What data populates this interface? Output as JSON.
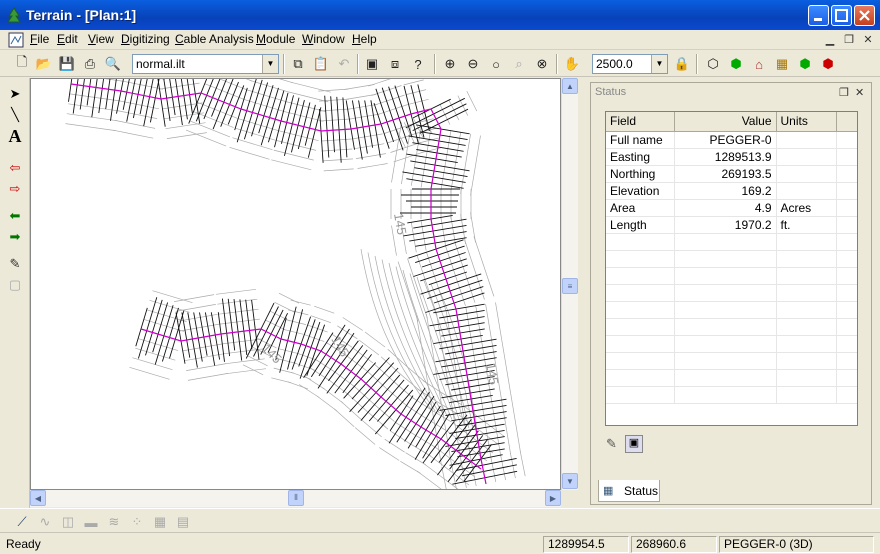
{
  "window": {
    "title": "Terrain - [Plan:1]"
  },
  "menu": [
    "File",
    "Edit",
    "View",
    "Digitizing",
    "Cable Analysis",
    "Module",
    "Window",
    "Help"
  ],
  "toolbar": {
    "layer_file": "normal.ilt",
    "scale": "2500.0"
  },
  "status_panel": {
    "title": "Status",
    "columns": [
      "Field",
      "Value",
      "Units"
    ],
    "rows": [
      {
        "field": "Full name",
        "value": "PEGGER-0",
        "units": ""
      },
      {
        "field": "Easting",
        "value": "1289513.9",
        "units": ""
      },
      {
        "field": "Northing",
        "value": "269193.5",
        "units": ""
      },
      {
        "field": "Elevation",
        "value": "169.2",
        "units": ""
      },
      {
        "field": "Area",
        "value": "4.9",
        "units": "Acres"
      },
      {
        "field": "Length",
        "value": "1970.2",
        "units": "ft."
      }
    ],
    "tab_label": "Status"
  },
  "map": {
    "contour_labels": [
      "145",
      "145",
      "145",
      "145"
    ]
  },
  "statusbar": {
    "message": "Ready",
    "easting": "1289954.5",
    "northing": "268960.6",
    "object": "PEGGER-0 (3D)"
  }
}
